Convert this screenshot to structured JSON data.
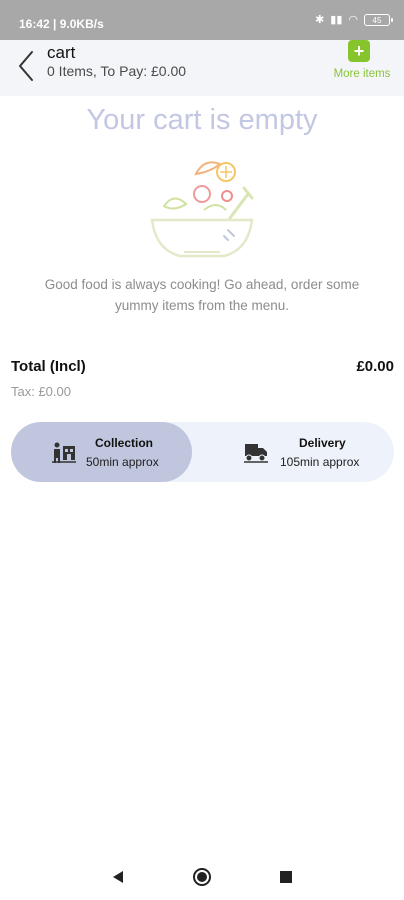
{
  "status_bar": {
    "time": "16:42",
    "speed": "9.0KB/s",
    "battery": "45"
  },
  "header": {
    "title": "cart",
    "subtitle": "0 Items, To Pay: £0.00",
    "more_items_label": "More items",
    "plus_glyph": "+"
  },
  "empty_state": {
    "title": "Your cart is empty",
    "message": "Good food is always cooking! Go ahead, order some yummy items from the menu.",
    "illustration": "salad-bowl-icon"
  },
  "totals": {
    "total_label": "Total (Incl)",
    "total_value": "£0.00",
    "tax_label": "Tax: £0.00"
  },
  "order_type": {
    "selected": "collection",
    "options": [
      {
        "id": "collection",
        "title": "Collection",
        "eta": "50min approx",
        "icon": "collection-store-icon"
      },
      {
        "id": "delivery",
        "title": "Delivery",
        "eta": "105min approx",
        "icon": "delivery-truck-icon"
      }
    ]
  },
  "colors": {
    "accent_green": "#86c42c",
    "empty_title": "#c2c7e3",
    "selected_option": "#bfc6de",
    "toggle_background": "#eef2fb"
  }
}
